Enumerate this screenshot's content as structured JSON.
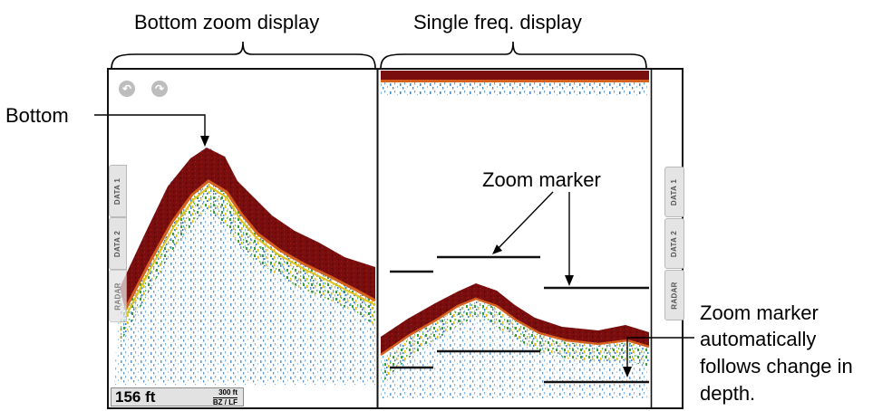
{
  "callouts": {
    "bottom_zoom": "Bottom zoom display",
    "single_freq": "Single freq. display",
    "bottom": "Bottom",
    "zoom_marker": "Zoom marker",
    "follows_line1": "Zoom marker",
    "follows_line2": "automatically",
    "follows_line3": "follows change in",
    "follows_line4": "depth."
  },
  "left_tabs": [
    "DATA 1",
    "DATA 2",
    "RADAR"
  ],
  "right_tabs": [
    "DATA 1",
    "DATA 2",
    "RADAR"
  ],
  "controls": {
    "back_icon": "undo-arrow",
    "forward_icon": "redo-arrow",
    "back_glyph": "↶",
    "forward_glyph": "↷"
  },
  "readout": {
    "depth": "156 ft",
    "range": "300 ft",
    "mode": "BZ / LF"
  },
  "colors": {
    "bottom_echo": "#7a0d0d",
    "echo_orange": "#d6601e",
    "echo_yellow": "#e2c21a",
    "echo_green": "#3b9e3a",
    "echo_blue": "#3f86c6",
    "frame": "#111111"
  }
}
